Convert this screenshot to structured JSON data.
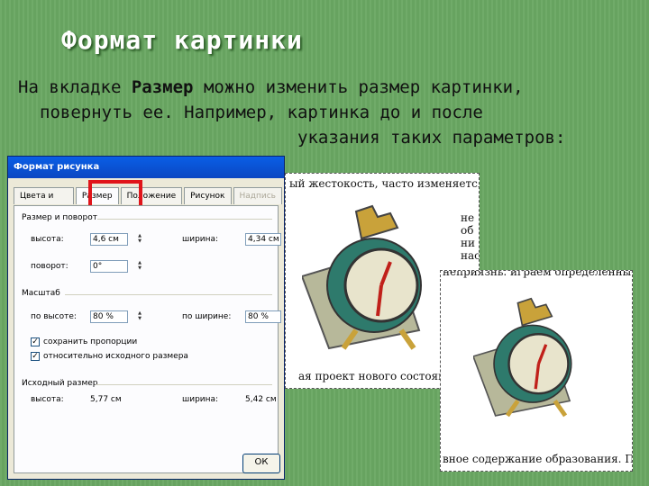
{
  "slide": {
    "title": "Формат картинки",
    "line1_prefix": "На вкладке ",
    "line1_bold": "Размер",
    "line1_suffix": "можно изменить размер картинки,",
    "line2": "повернуть ее. Например, картинка до и после",
    "line3": "указания таких параметров:"
  },
  "dialog": {
    "title": "Формат рисунка",
    "tabs": [
      "Цвета и линии",
      "Размер",
      "Положение",
      "Рисунок",
      "Надпись"
    ],
    "group_size": "Размер и поворот",
    "height_label": "высота:",
    "height_value": "4,6 см",
    "width_label": "ширина:",
    "width_value": "4,34 см",
    "rotation_label": "поворот:",
    "rotation_value": "0°",
    "group_scale": "Масштаб",
    "scale_h_label": "по высоте:",
    "scale_h_value": "80 %",
    "scale_w_label": "по ширине:",
    "scale_w_value": "80 %",
    "check1": "сохранить пропорции",
    "check2": "относительно исходного размера",
    "group_orig": "Исходный размер",
    "orig_h_label": "высота:",
    "orig_h_value": "5,77 см",
    "orig_w_label": "ширина:",
    "orig_w_value": "5,42 см",
    "ok": "ОК"
  },
  "doc_before": {
    "top": "ый жестокость, часто изменяется",
    "r1": "не",
    "r2": "об",
    "r3": "ни",
    "r4": "нас",
    "bottom": "ая проект нового состояния"
  },
  "doc_after": {
    "top": "неприязнь. играем определенные",
    "bottom": "вное содержание образования. Поз"
  }
}
